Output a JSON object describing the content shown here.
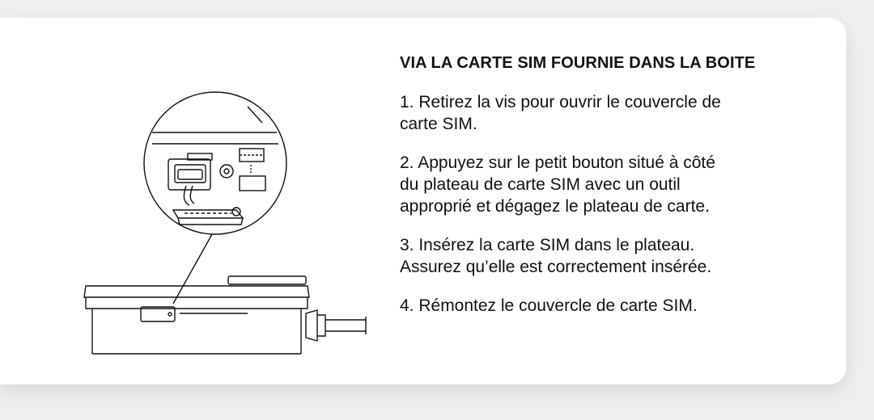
{
  "instructions": {
    "heading": "VIA LA CARTE SIM FOURNIE DANS LA BOITE",
    "steps": [
      {
        "lines": [
          "1. Retirez la vis pour ouvrir le couvercle de",
          "carte SIM."
        ]
      },
      {
        "lines": [
          "2. Appuyez sur le petit bouton situé à côté",
          "du plateau de carte SIM avec un outil",
          "approprié et dégagez le plateau de carte."
        ]
      },
      {
        "lines": [
          "3. Insérez la carte SIM dans le plateau.",
          "Assurez qu’elle est correctement insérée."
        ]
      },
      {
        "lines": [
          "4. Rémontez le couvercle de carte SIM."
        ]
      }
    ]
  },
  "colors": {
    "background": "#efefef",
    "card": "#ffffff",
    "text": "#111111",
    "line_art": "#111111"
  }
}
